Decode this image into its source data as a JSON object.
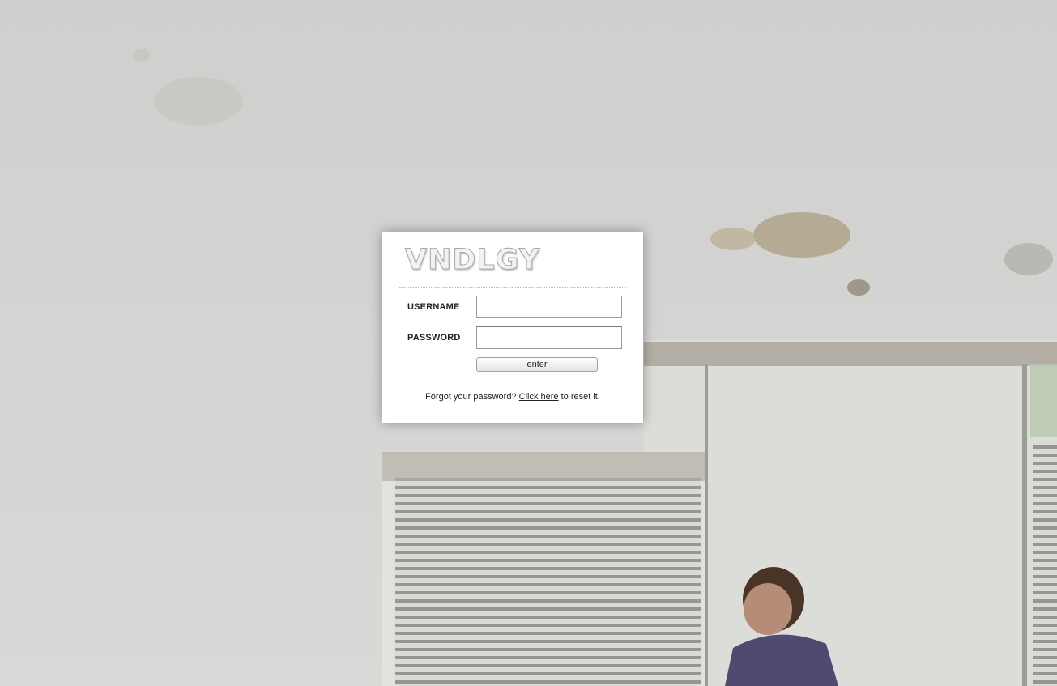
{
  "brand": {
    "logo_text": "VNDLGY"
  },
  "form": {
    "username_label": "USERNAME",
    "password_label": "PASSWORD",
    "username_value": "",
    "password_value": "",
    "enter_label": "enter"
  },
  "forgot": {
    "prefix": "Forgot your password?",
    "link_text": "Click here",
    "suffix": "to reset it."
  },
  "colors": {
    "background": "#d4d4d2",
    "panel": "#ffffff",
    "text": "#222222"
  }
}
